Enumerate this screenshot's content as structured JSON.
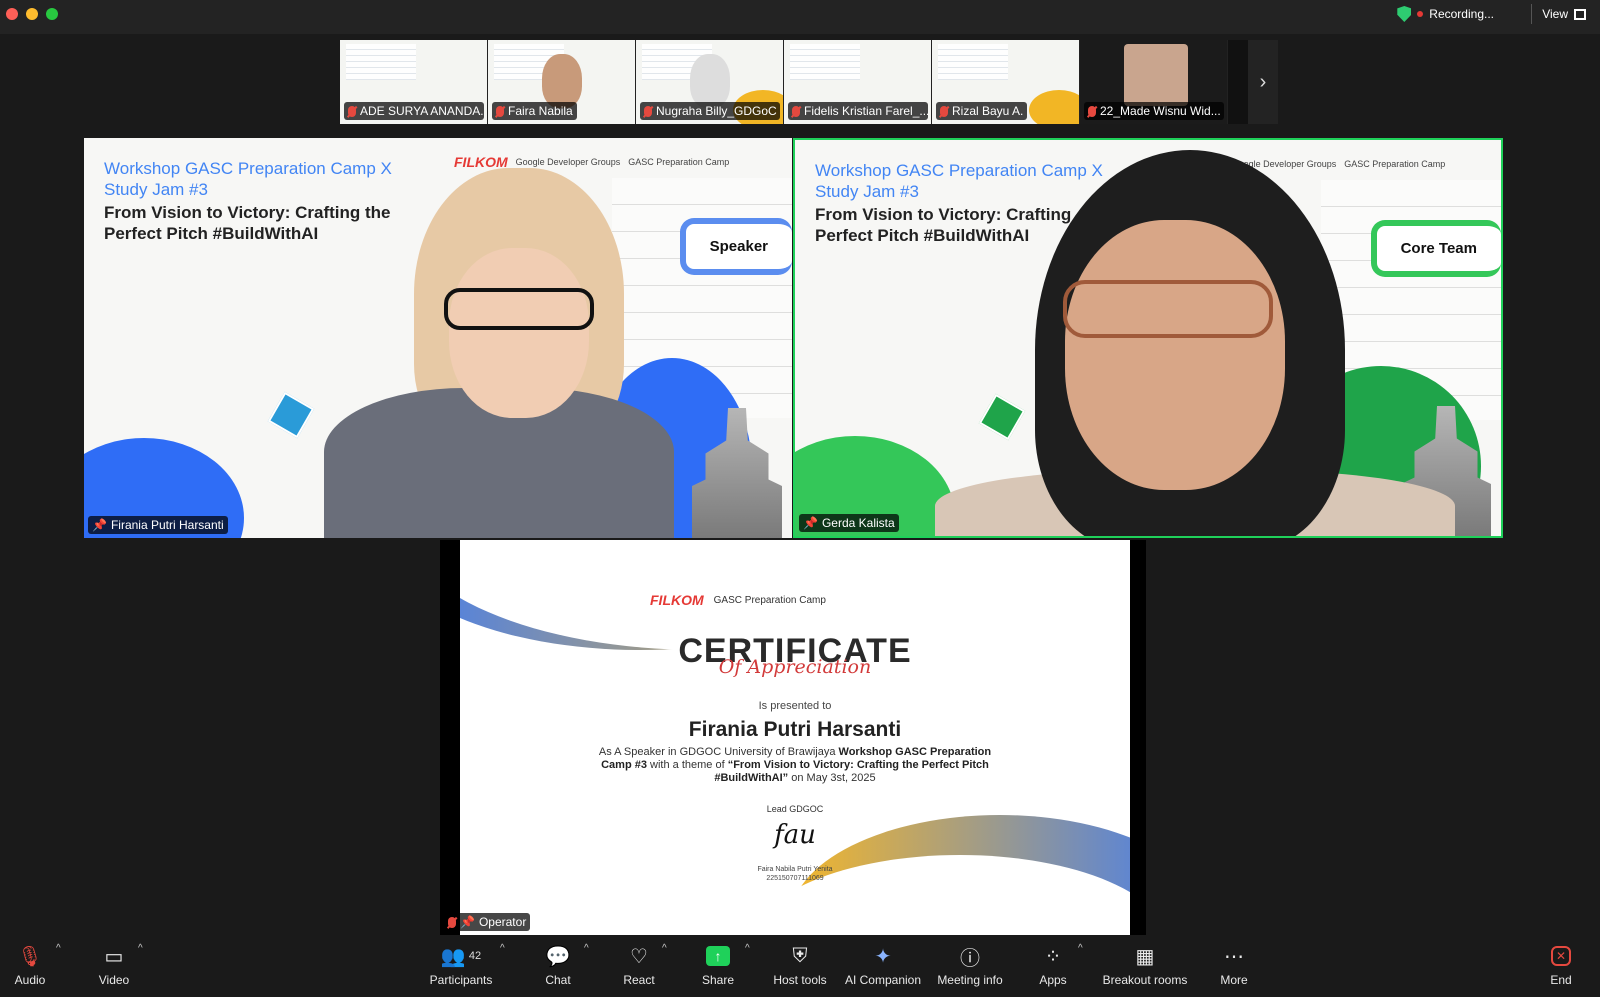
{
  "window": {
    "recording_label": "Recording...",
    "view_label": "View"
  },
  "gallery": {
    "tiles": [
      {
        "name": "ADE SURYA ANANDA..."
      },
      {
        "name": "Faira Nabila"
      },
      {
        "name": "Nugraha Billy_GDGoC ..."
      },
      {
        "name": "Fidelis Kristian Farel_..."
      },
      {
        "name": "Rizal Bayu A."
      },
      {
        "name": "22_Made Wisnu Wid..."
      }
    ]
  },
  "slide": {
    "title_line1": "Workshop GASC Preparation Camp X",
    "title_line2": "Study Jam #3",
    "subtitle_line1": "From Vision to Victory: Crafting the",
    "subtitle_line2": "Perfect Pitch #BuildWithAI",
    "subtitle_v2_line1": "From Vision to Victory: Crafting",
    "logo_filkom": "FILKOM",
    "logo_gdg": "Google Developer Groups",
    "logo_gasc": "GASC Preparation Camp"
  },
  "videos": [
    {
      "name": "Firania Putri Harsanti",
      "role": "Speaker"
    },
    {
      "name": "Gerda Kalista",
      "role": "Core Team"
    }
  ],
  "share": {
    "presenter": "Operator",
    "certificate": {
      "title": "CERTIFICATE",
      "subtitle": "Of Appreciation",
      "presented": "Is presented to",
      "recipient": "Firania Putri Harsanti",
      "body_prefix": "As A Speaker in GDGOC University of Brawijaya",
      "body_event": "Workshop GASC Preparation Camp #3",
      "body_mid": "with a theme of",
      "body_theme": "“From Vision to Victory: Crafting the Perfect Pitch #BuildWithAI”",
      "body_suffix": "on May 3st, 2025",
      "lead": "Lead GDGOC",
      "signature": "fau",
      "signer": "Faira Nabila Putri Yenita",
      "signer_id": "225150707111069"
    }
  },
  "toolbar": {
    "audio": "Audio",
    "video": "Video",
    "participants": "Participants",
    "participants_count": "42",
    "chat": "Chat",
    "react": "React",
    "share": "Share",
    "host_tools": "Host tools",
    "ai_companion": "AI Companion",
    "meeting_info": "Meeting info",
    "apps": "Apps",
    "breakout_rooms": "Breakout rooms",
    "more": "More",
    "end": "End"
  },
  "colors": {
    "active_speaker": "#1fd15a",
    "share_green": "#1fd15a",
    "mic_off": "#e5493f",
    "slide_blue": "#4285f4"
  }
}
